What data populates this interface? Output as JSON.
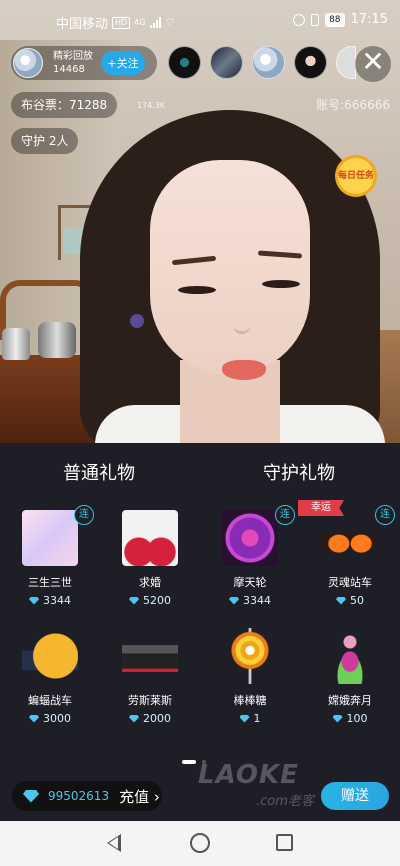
{
  "status_bar": {
    "carrier": "中国移动",
    "hd": "HD",
    "net": "4G",
    "battery": "88",
    "time": "17:15"
  },
  "host": {
    "name": "精彩回放",
    "id_number": "14468",
    "follow_label": "+关注"
  },
  "close_label": "✕",
  "stats": {
    "ticket_label": "布谷票：71288",
    "small_count": "174.3K",
    "account_label": "账号:666666",
    "guard_label": "守护 2人"
  },
  "daily_task_label": "每日任务",
  "tabs": {
    "normal": "普通礼物",
    "guard": "守护礼物"
  },
  "lucky_tag": "幸运",
  "combo_tag": "连",
  "gifts": [
    {
      "name": "三生三世",
      "price": "3344"
    },
    {
      "name": "求婚",
      "price": "5200"
    },
    {
      "name": "摩天轮",
      "price": "3344"
    },
    {
      "name": "灵魂站车",
      "price": "50"
    },
    {
      "name": "蝙蝠战车",
      "price": "3000"
    },
    {
      "name": "劳斯莱斯",
      "price": "2000"
    },
    {
      "name": "棒棒糖",
      "price": "1"
    },
    {
      "name": "嫦娥奔月",
      "price": "100"
    }
  ],
  "balance": {
    "amount": "99502613",
    "recharge_label": "充值 ›"
  },
  "send_label": "赠送",
  "watermark": {
    "brand": "LAOKE",
    "sub": ".com老客"
  },
  "colors": {
    "accent": "#27a9e8",
    "panel_bg": "#1e1e27",
    "gem": "#4bc6f0",
    "lucky_tag": "#e23c4b"
  }
}
